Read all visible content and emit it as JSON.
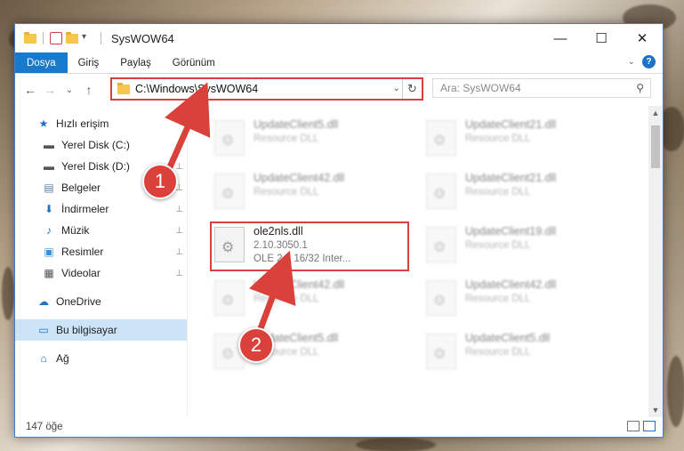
{
  "window": {
    "title": "SysWOW64",
    "controls": {
      "minimize": "—",
      "maximize": "☐",
      "close": "✕"
    }
  },
  "ribbon": {
    "tabs": [
      "Dosya",
      "Giriş",
      "Paylaş",
      "Görünüm"
    ],
    "active_tab": "Dosya",
    "help": "?"
  },
  "nav_buttons": {
    "back": "←",
    "forward": "→",
    "recent": "⌄",
    "up": "↑"
  },
  "address": {
    "path": "C:\\Windows\\SysWOW64",
    "dropdown": "⌄",
    "refresh": "↻"
  },
  "search": {
    "placeholder": "Ara: SysWOW64",
    "icon": "search-icon"
  },
  "sidebar": {
    "items": [
      {
        "label": "Hızlı erişim",
        "icon": "star-icon",
        "glyph": "★",
        "color": "#1c72c8",
        "pinned": false
      },
      {
        "label": "Yerel Disk (C:)",
        "icon": "drive-icon",
        "glyph": "▬",
        "color": "#555555",
        "pinned": false
      },
      {
        "label": "Yerel Disk (D:)",
        "icon": "drive-icon",
        "glyph": "▬",
        "color": "#555555",
        "pinned": true
      },
      {
        "label": "Belgeler",
        "icon": "document-icon",
        "glyph": "▤",
        "color": "#5a7fa8",
        "pinned": true
      },
      {
        "label": "İndirmeler",
        "icon": "download-icon",
        "glyph": "⬇",
        "color": "#1c72c8",
        "pinned": true
      },
      {
        "label": "Müzik",
        "icon": "music-icon",
        "glyph": "♪",
        "color": "#1c72c8",
        "pinned": true
      },
      {
        "label": "Resimler",
        "icon": "pictures-icon",
        "glyph": "▣",
        "color": "#3d8fd4",
        "pinned": true
      },
      {
        "label": "Videolar",
        "icon": "video-icon",
        "glyph": "▦",
        "color": "#555555",
        "pinned": true
      },
      {
        "label": "OneDrive",
        "icon": "cloud-icon",
        "glyph": "☁",
        "color": "#1c72c8",
        "pinned": false
      },
      {
        "label": "Bu bilgisayar",
        "icon": "computer-icon",
        "glyph": "▭",
        "color": "#1c72c8",
        "pinned": false
      },
      {
        "label": "Ağ",
        "icon": "network-icon",
        "glyph": "⌂",
        "color": "#1c72c8",
        "pinned": false
      }
    ],
    "pin_glyph": "📌"
  },
  "files": {
    "col1": [
      {
        "name": "UpdateClient5.dll",
        "line1": "Resource DLL",
        "line2": ""
      },
      {
        "name": "UpdateClient42.dll",
        "line1": "Resource DLL",
        "line2": ""
      },
      {
        "name": "ole2nls.dll",
        "line1": "2.10.3050.1",
        "line2": "OLE 2.1 16/32 Inter..."
      },
      {
        "name": "UpdateClient42.dll",
        "line1": "Resource DLL",
        "line2": ""
      },
      {
        "name": "UpdateClient5.dll",
        "line1": "Resource DLL",
        "line2": ""
      }
    ],
    "col2": [
      {
        "name": "UpdateClient21.dll",
        "line1": "Resource DLL"
      },
      {
        "name": "UpdateClient21.dll",
        "line1": "Resource DLL"
      },
      {
        "name": "UpdateClient19.dll",
        "line1": "Resource DLL"
      },
      {
        "name": "UpdateClient42.dll",
        "line1": "Resource DLL"
      },
      {
        "name": "UpdateClient5.dll",
        "line1": "Resource DLL"
      }
    ]
  },
  "status": {
    "count": "147 öğe"
  },
  "annotations": {
    "step1": "1",
    "step2": "2"
  },
  "colors": {
    "accent": "#1979ca",
    "highlight": "#d9413a"
  }
}
